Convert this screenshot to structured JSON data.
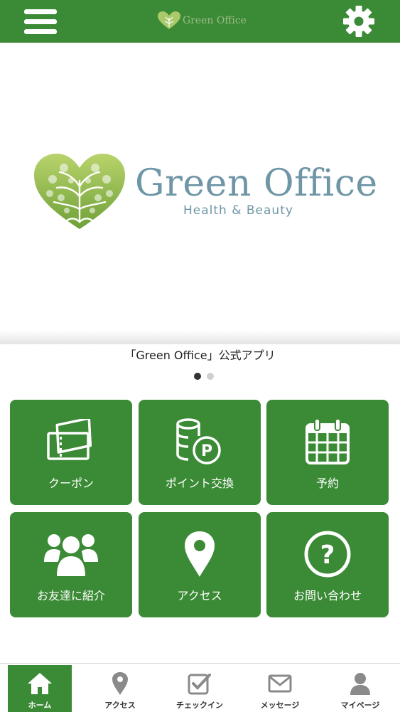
{
  "header": {
    "logo_text": "Green Office",
    "menu_icon": "hamburger-menu-icon",
    "settings_icon": "gear-icon",
    "brand_color": "#3b8a35"
  },
  "hero": {
    "title": "Green Office",
    "subtitle": "Health & Beauty",
    "caption": "「Green Office」公式アプリ",
    "slide_count": 2,
    "active_slide": 1
  },
  "tiles": [
    {
      "label": "クーポン",
      "icon": "ticket-icon"
    },
    {
      "label": "ポイント交換",
      "icon": "coins-points-icon"
    },
    {
      "label": "予約",
      "icon": "calendar-icon"
    },
    {
      "label": "お友達に紹介",
      "icon": "group-people-icon"
    },
    {
      "label": "アクセス",
      "icon": "map-pin-icon"
    },
    {
      "label": "お問い合わせ",
      "icon": "question-circle-icon"
    }
  ],
  "nav": [
    {
      "label": "ホーム",
      "icon": "home-icon",
      "active": true
    },
    {
      "label": "アクセス",
      "icon": "map-pin-icon",
      "active": false
    },
    {
      "label": "チェックイン",
      "icon": "checkin-icon",
      "active": false
    },
    {
      "label": "メッセージ",
      "icon": "envelope-icon",
      "active": false
    },
    {
      "label": "マイページ",
      "icon": "user-icon",
      "active": false
    }
  ]
}
